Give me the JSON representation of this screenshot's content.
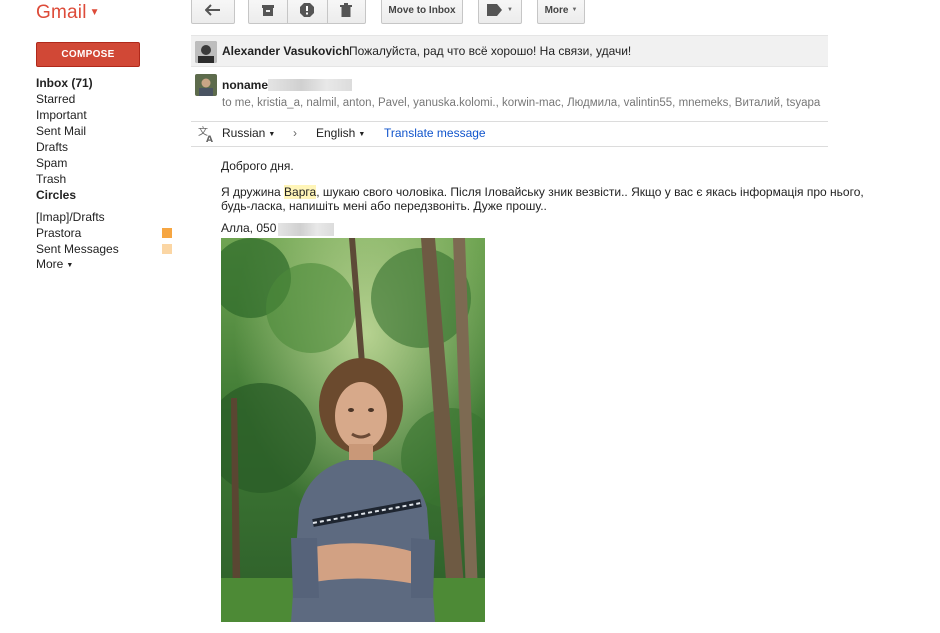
{
  "app": {
    "logo": "Gmail"
  },
  "toolbar": {
    "move_to_inbox": "Move to Inbox",
    "more": "More"
  },
  "nav": {
    "compose": "COMPOSE",
    "items": [
      {
        "label": "Inbox (71)"
      },
      {
        "label": "Starred"
      },
      {
        "label": "Important"
      },
      {
        "label": "Sent Mail"
      },
      {
        "label": "Drafts"
      },
      {
        "label": "Spam"
      },
      {
        "label": "Trash"
      },
      {
        "label": "Circles"
      }
    ],
    "labels": [
      {
        "label": "[Imap]/Drafts"
      },
      {
        "label": "Prastora",
        "color": "#f6a642"
      },
      {
        "label": "Sent Messages",
        "color": "#fbd6a4"
      },
      {
        "label": "More"
      }
    ]
  },
  "thread": {
    "msg1": {
      "sender": "Alexander Vasukovich",
      "snippet": "Пожалуйста, рад что всё хорошо! На связи, удачи!"
    },
    "msg2": {
      "sender": "noname",
      "recipients": "to me, kristia_a, nalmil, anton, Pavel, yanuska.kolomi., korwin-mac, Людмила, valintin55, mnemeks, Виталий, tsyapa"
    },
    "translate": {
      "from": "Russian",
      "to": "English",
      "action": "Translate message"
    },
    "body": {
      "greeting": "Доброго дня.",
      "line1_a": "Я дружина ",
      "line1_highlight": "Варга",
      "line1_b": ", шукаю свого чоловіка. Після Іловайську зник везвісти.. Якщо у вас є якась інформація про нього,",
      "line2": "будь-ласка, напишіть мені або передзвоніть. Дуже прошу..",
      "signature": "Алла, 050"
    }
  },
  "colors": {
    "brand": "#dd4b39",
    "compose": "#d14836",
    "link": "#15c"
  }
}
